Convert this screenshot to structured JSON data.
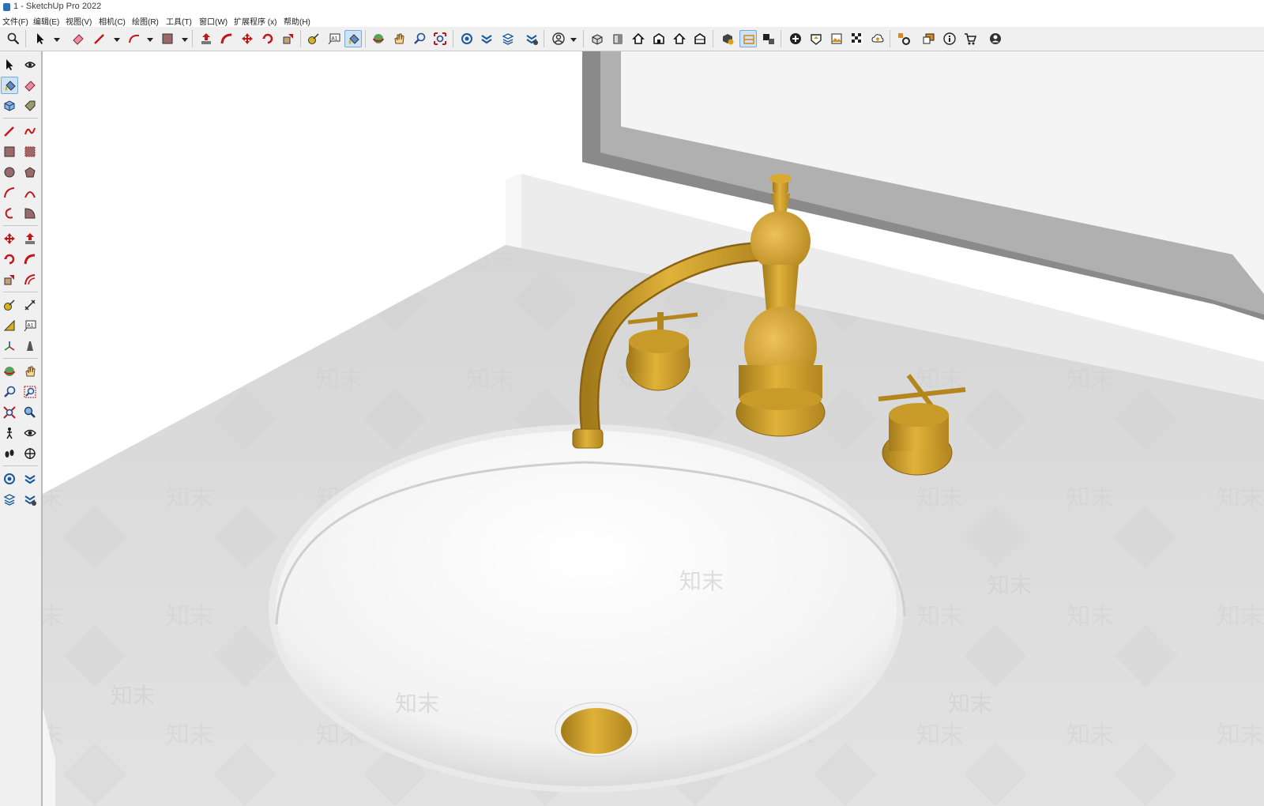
{
  "window": {
    "title": "1 - SketchUp Pro 2022"
  },
  "menu": [
    {
      "label": "文件(F)"
    },
    {
      "label": "编辑(E)"
    },
    {
      "label": "视图(V)"
    },
    {
      "label": "相机(C)"
    },
    {
      "label": "绘图(R)"
    },
    {
      "label": "工具(T)"
    },
    {
      "label": "窗口(W)"
    },
    {
      "label": "扩展程序 (x)"
    },
    {
      "label": "帮助(H)"
    }
  ],
  "toolbar": {
    "tools": [
      {
        "icon": "zoom-icon"
      },
      {
        "icon": "select-arrow-icon",
        "dropdown": true
      },
      {
        "icon": "eraser-icon"
      },
      {
        "icon": "pencil-line-icon",
        "dropdown": true
      },
      {
        "icon": "arc-icon",
        "dropdown": true
      },
      {
        "icon": "rectangle-icon",
        "dropdown": true
      },
      {
        "icon": "push-pull-icon"
      },
      {
        "icon": "follow-me-icon"
      },
      {
        "icon": "move-icon"
      },
      {
        "icon": "rotate-icon"
      },
      {
        "icon": "scale-icon"
      },
      {
        "icon": "tape-measure-icon"
      },
      {
        "icon": "text-label-icon"
      },
      {
        "icon": "paint-bucket-icon",
        "active": true
      },
      {
        "icon": "orbit-icon"
      },
      {
        "icon": "pan-hand-icon"
      },
      {
        "icon": "zoom-glass-icon"
      },
      {
        "icon": "zoom-extents-icon"
      },
      {
        "icon": "warehouse-icon"
      },
      {
        "icon": "extension-warehouse-icon"
      },
      {
        "icon": "layout-icon"
      },
      {
        "icon": "model-info-icon"
      },
      {
        "icon": "user-account-icon",
        "dropdown": true
      },
      {
        "icon": "iso-view-icon"
      },
      {
        "icon": "top-view-icon"
      },
      {
        "icon": "front-view-icon"
      },
      {
        "icon": "right-view-icon"
      },
      {
        "icon": "back-view-icon"
      },
      {
        "icon": "left-view-icon"
      },
      {
        "icon": "section-plane-icon"
      },
      {
        "icon": "section-display-icon",
        "active": true
      },
      {
        "icon": "section-cut-icon"
      },
      {
        "icon": "add-location-icon"
      },
      {
        "icon": "terrain-icon"
      },
      {
        "icon": "photo-texture-icon"
      },
      {
        "icon": "styles-icon"
      },
      {
        "icon": "cloud-upload-icon"
      },
      {
        "icon": "extension-manager-icon"
      },
      {
        "icon": "dynamic-component-icon"
      },
      {
        "icon": "info-icon"
      },
      {
        "icon": "cart-icon"
      },
      {
        "icon": "account-icon"
      }
    ]
  },
  "left_toolbar": {
    "tools": [
      {
        "icon": "select-icon"
      },
      {
        "icon": "orbit-icon"
      },
      {
        "icon": "paint-bucket-icon",
        "active": true
      },
      {
        "icon": "eraser-icon"
      },
      {
        "icon": "component-icon"
      },
      {
        "icon": "tag-icon"
      },
      {
        "icon": "line-icon"
      },
      {
        "icon": "freehand-icon"
      },
      {
        "icon": "rectangle-icon"
      },
      {
        "icon": "rotated-rectangle-icon"
      },
      {
        "icon": "circle-icon"
      },
      {
        "icon": "polygon-icon"
      },
      {
        "icon": "arc-icon"
      },
      {
        "icon": "two-point-arc-icon"
      },
      {
        "icon": "three-point-arc-icon"
      },
      {
        "icon": "pie-icon"
      },
      {
        "icon": "move-icon"
      },
      {
        "icon": "push-pull-icon"
      },
      {
        "icon": "rotate-icon"
      },
      {
        "icon": "follow-me-icon"
      },
      {
        "icon": "scale-icon"
      },
      {
        "icon": "offset-icon"
      },
      {
        "icon": "tape-measure-icon"
      },
      {
        "icon": "dimension-icon"
      },
      {
        "icon": "protractor-icon"
      },
      {
        "icon": "text-icon"
      },
      {
        "icon": "axes-icon"
      },
      {
        "icon": "3d-text-icon"
      },
      {
        "icon": "orbit-icon"
      },
      {
        "icon": "pan-icon"
      },
      {
        "icon": "zoom-icon"
      },
      {
        "icon": "zoom-window-icon"
      },
      {
        "icon": "zoom-extents-icon"
      },
      {
        "icon": "position-camera-icon"
      },
      {
        "icon": "walk-icon"
      },
      {
        "icon": "look-around-icon"
      },
      {
        "icon": "footprints-icon"
      },
      {
        "icon": "section-plane-icon"
      },
      {
        "icon": "warehouse-icon"
      },
      {
        "icon": "extension-warehouse-icon"
      },
      {
        "icon": "layout-send-icon"
      },
      {
        "icon": "extension-manager-icon"
      }
    ]
  },
  "colors": {
    "brass": "#d4a632",
    "brass_dark": "#a27a1a",
    "counter": "#dcdcdc",
    "mirror_frame": "#8a8a8a",
    "sink": "#ffffff"
  },
  "watermark": {
    "text": "知末"
  }
}
